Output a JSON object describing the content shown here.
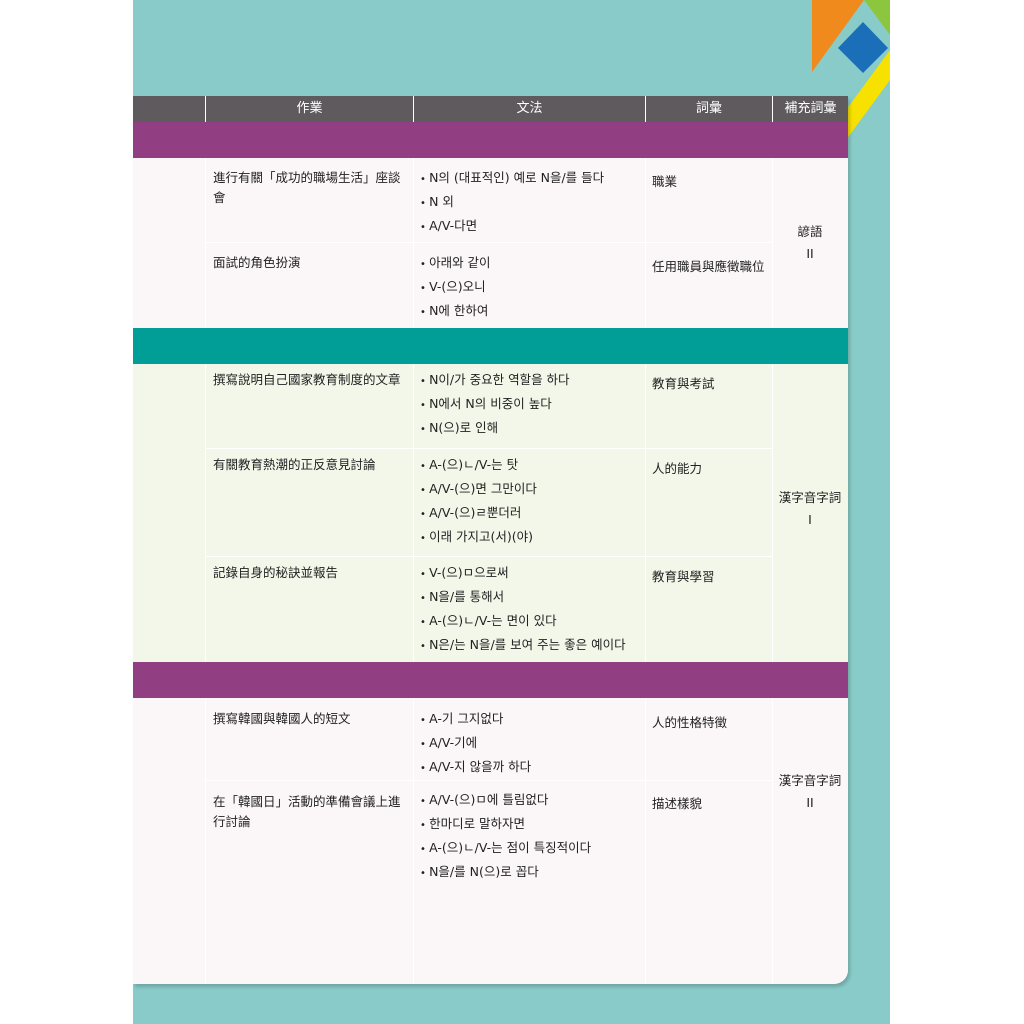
{
  "header": {
    "col_task": "作業",
    "col_grammar": "文法",
    "col_vocab": "詞彙",
    "col_supp": "補充詞彙"
  },
  "sections": [
    {
      "supp": [
        "諺語",
        "II"
      ],
      "rows": [
        {
          "task": "進行有關「成功的職場生活」座談會",
          "grammar": [
            "N의 (대표적인) 예로 N을/를 들다",
            "N 외",
            "A/V-다면"
          ],
          "vocab": "職業"
        },
        {
          "task": "面試的角色扮演",
          "grammar": [
            "아래와 같이",
            "V-(으)오니",
            "N에 한하여"
          ],
          "vocab": "任用職員與應徵職位"
        }
      ]
    },
    {
      "supp": [
        "漢字音字詞",
        "I"
      ],
      "rows": [
        {
          "task": "撰寫說明自己國家教育制度的文章",
          "grammar": [
            "N이/가 중요한 역할을 하다",
            "N에서 N의 비중이 높다",
            "N(으)로 인해"
          ],
          "vocab": "教育與考試"
        },
        {
          "task": "有關教育熱潮的正反意見討論",
          "grammar": [
            "A-(으)ㄴ/V-는 탓",
            "A/V-(으)면 그만이다",
            "A/V-(으)ㄹ뿐더러",
            "이래 가지고(서)(야)"
          ],
          "vocab": "人的能力"
        },
        {
          "task": "記錄自身的秘訣並報告",
          "grammar": [
            "V-(으)ㅁ으로써",
            "N을/를 통해서",
            "A-(으)ㄴ/V-는 면이 있다",
            "N은/는 N을/를 보여 주는 좋은 예이다"
          ],
          "vocab": "教育與學習"
        }
      ]
    },
    {
      "supp": [
        "漢字音字詞",
        "II"
      ],
      "rows": [
        {
          "task": "撰寫韓國與韓國人的短文",
          "grammar": [
            "A-기 그지없다",
            "A/V-기에",
            "A/V-지 않을까 하다"
          ],
          "vocab": "人的性格特徵"
        },
        {
          "task": "在「韓國日」活動的準備會議上進行討論",
          "grammar": [
            "A/V-(으)ㅁ에 틀림없다",
            "한마디로 말하자면",
            "A-(으)ㄴ/V-는 점이 특징적이다",
            "N을/를 N(으)로 꼽다"
          ],
          "vocab": "描述樣貌"
        }
      ]
    }
  ]
}
